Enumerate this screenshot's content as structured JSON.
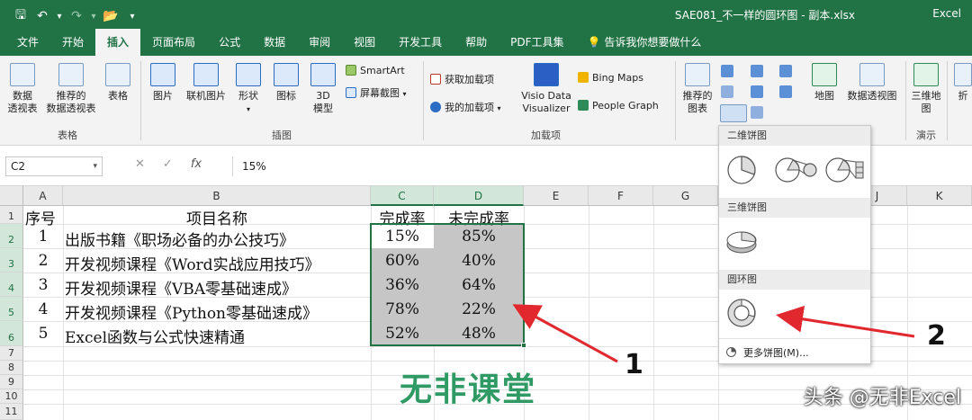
{
  "titlebar": {
    "qat": [
      {
        "name": "save-icon",
        "glyph": "🖫"
      },
      {
        "name": "undo-icon",
        "glyph": "↶"
      },
      {
        "name": "undo-dropdown-icon",
        "glyph": "▾"
      },
      {
        "name": "redo-icon",
        "glyph": "↷"
      },
      {
        "name": "redo-dropdown-icon",
        "glyph": "▾"
      },
      {
        "name": "open-folder-icon",
        "glyph": "📂"
      },
      {
        "name": "customize-qat-icon",
        "glyph": "▾"
      }
    ],
    "document_title": "SAE081_不一样的圆环图 - 副本.xlsx",
    "app_name": "Excel"
  },
  "tabs": [
    "文件",
    "开始",
    "插入",
    "页面布局",
    "公式",
    "数据",
    "审阅",
    "视图",
    "开发工具",
    "帮助",
    "PDF工具集"
  ],
  "active_tab": "插入",
  "tell_me": "告诉我你想要做什么",
  "ribbon": {
    "tables": {
      "pivot": "数据\n透视表",
      "recommended_pivot": "推荐的\n数据透视表",
      "table": "表格",
      "group": "表格"
    },
    "illustrations": {
      "picture": "图片",
      "online_picture": "联机图片",
      "shapes": "形状",
      "icons": "图标",
      "model3d": "3D\n模型",
      "smartart": "SmartArt",
      "screenshot": "屏幕截图",
      "group": "插图"
    },
    "addins": {
      "get_addins": "获取加载项",
      "my_addins": "我的加载项",
      "visio": "Visio Data\nVisualizer",
      "bing_maps": "Bing Maps",
      "people_graph": "People Graph",
      "group": "加载项"
    },
    "charts": {
      "recommended": "推荐的\n图表",
      "map": "地图",
      "pivot_chart": "数据透视图"
    },
    "tours": {
      "map3d": "三维地\n图",
      "group": "演示"
    },
    "sparkline_partial": "折"
  },
  "formula_bar": {
    "name_box": "C2",
    "formula": "15%",
    "cancel": "✕",
    "enter": "✓",
    "fx": "fx"
  },
  "columns": [
    "A",
    "B",
    "C",
    "D",
    "E",
    "F",
    "G",
    "H",
    "I",
    "J",
    "K"
  ],
  "rows": [
    "1",
    "2",
    "3",
    "4",
    "5",
    "6",
    "7",
    "8",
    "9",
    "10",
    "11"
  ],
  "table": {
    "headers": [
      "序号",
      "项目名称",
      "完成率",
      "未完成率"
    ],
    "rows": [
      [
        "1",
        "出版书籍《职场必备的办公技巧》",
        "15%",
        "85%"
      ],
      [
        "2",
        "开发视频课程《Word实战应用技巧》",
        "60%",
        "40%"
      ],
      [
        "3",
        "开发视频课程《VBA零基础速成》",
        "36%",
        "64%"
      ],
      [
        "4",
        "开发视频课程《Python零基础速成》",
        "78%",
        "22%"
      ],
      [
        "5",
        "Excel函数与公式快速精通",
        "52%",
        "48%"
      ]
    ]
  },
  "dropdown": {
    "section_2d": "二维饼图",
    "section_3d": "三维饼图",
    "section_donut": "圆环图",
    "more": "更多饼图(M)..."
  },
  "annotations": [
    "1",
    "2"
  ],
  "watermark": "无非课堂",
  "signature": "头条 @无非Excel",
  "colors": {
    "excel_green": "#217346",
    "annotation_red": "#e0282e",
    "watermark_green": "#2f9a63"
  }
}
